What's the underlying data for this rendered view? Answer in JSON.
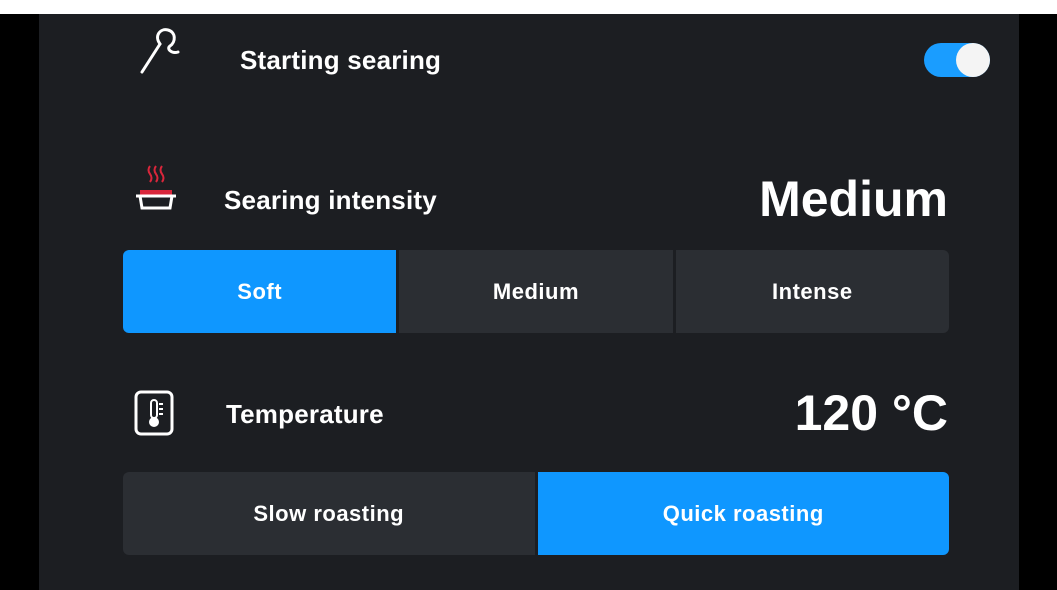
{
  "searing_start": {
    "label": "Starting searing",
    "icon": "probe-icon",
    "toggle_on": true
  },
  "intensity": {
    "label": "Searing intensity",
    "icon": "pan-heat-icon",
    "value": "Medium",
    "options": [
      "Soft",
      "Medium",
      "Intense"
    ],
    "selected": "Soft"
  },
  "temperature": {
    "label": "Temperature",
    "icon": "thermometer-icon",
    "value": "120 °C",
    "options": [
      "Slow roasting",
      "Quick roasting"
    ],
    "selected": "Quick roasting"
  },
  "colors": {
    "accent": "#0f97ff",
    "panel": "#1c1e22",
    "segment": "#2b2e33",
    "heat_red": "#d9263b"
  }
}
